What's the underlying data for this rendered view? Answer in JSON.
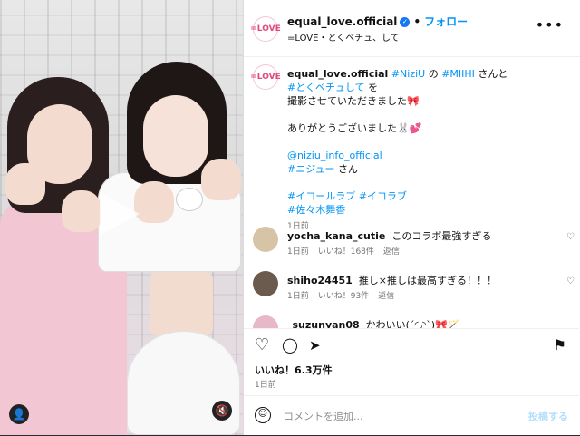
{
  "post": {
    "account": "equal_love.official",
    "avatar_text": "=LOVE",
    "follow_label": "フォロー",
    "subtitle": "=LOVE・とくベチュ、して",
    "caption": {
      "user": "equal_love.official",
      "line1_tags": [
        "#NiziU",
        "#MIIHI"
      ],
      "line1_suffix": "さんと",
      "line2_tag": "#とくベチュして",
      "line2_suffix": "を",
      "line3": "撮影させていただきました🎀",
      "line4": "ありがとうございました🐰💕",
      "mention": "@niziu_info_official",
      "niziu_tag": "#ニジュー",
      "niziu_suffix": "さん",
      "tags_line1": "#イコールラブ #イコラブ",
      "tags_line2": "#佐々木舞香",
      "time": "1日前"
    },
    "comments": [
      {
        "user": "yocha_kana_cutie",
        "text": "このコラボ最強すぎる",
        "time": "1日前",
        "likes": "いいね！168件",
        "reply": "返信",
        "avatar_color": "#d7c3a6"
      },
      {
        "user": "shiho24451",
        "text": "推し×推しは最高すぎる！！！",
        "time": "1日前",
        "likes": "いいね！93件",
        "reply": "返信",
        "avatar_color": "#6b5a4e"
      },
      {
        "user": "_suzunyan08",
        "text": "かわいい(´◜◞◝`)🎀🪄",
        "time": "",
        "likes": "",
        "reply": "",
        "avatar_color": "#e6b8c8"
      }
    ],
    "likes": "いいね！6.3万件",
    "time": "1日前",
    "comment_placeholder": "コメントを追加...",
    "post_label": "投稿する"
  },
  "icons": {
    "heart": "♡",
    "comment": "◯",
    "share": "➤",
    "save": "⚑",
    "more": "•••",
    "emoji": "☺",
    "verified": "✓",
    "user_tag": "👤",
    "mute": "🔇"
  }
}
